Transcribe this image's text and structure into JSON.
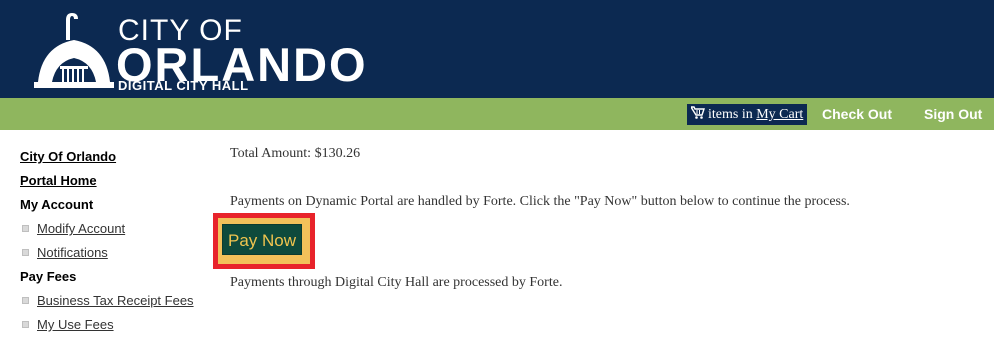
{
  "header": {
    "logo_line1": "CITY OF",
    "logo_line2": "ORLANDO",
    "logo_line3": "DIGITAL CITY HALL",
    "logo_icon": "city-hall-dome-icon"
  },
  "navbar": {
    "cart_prefix": "items in",
    "cart_link": "My Cart",
    "cart_icon": "shopping-cart-icon",
    "checkout": "Check Out",
    "signout": "Sign Out"
  },
  "sidebar": {
    "city_link": "City Of Orlando",
    "portal_home": "Portal Home",
    "my_account": "My Account",
    "account_items": [
      "Modify Account",
      "Notifications"
    ],
    "pay_fees": "Pay Fees",
    "fee_items": [
      "Business Tax Receipt Fees",
      "My Use Fees"
    ]
  },
  "main": {
    "total": "Total Amount: $130.26",
    "info": "Payments on Dynamic Portal are handled by Forte. Click the \"Pay Now\" button below to continue the process.",
    "pay_button": "Pay Now",
    "processed": "Payments through Digital City Hall are processed by Forte."
  },
  "colors": {
    "header_bg": "#0c2951",
    "nav_bg": "#8fb65e",
    "button_bg": "#0e4a3c",
    "button_text": "#f0c44f",
    "highlight_border": "#e8232b"
  }
}
